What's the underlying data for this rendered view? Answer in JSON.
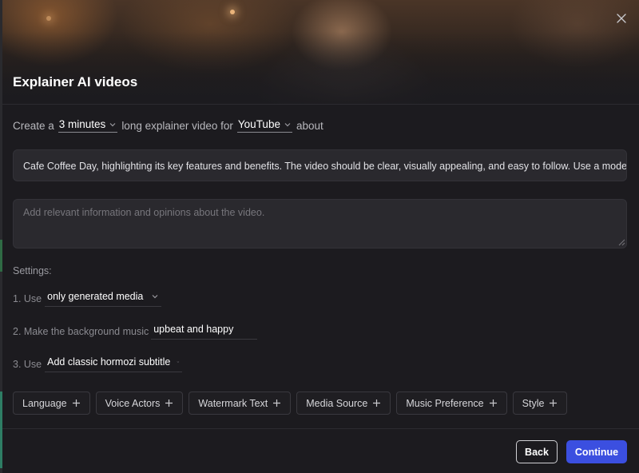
{
  "modal": {
    "title": "Explainer AI videos",
    "close_icon": "close-icon"
  },
  "prompt": {
    "prefix": "Create a",
    "duration": "3 minutes",
    "middle": "long explainer video for",
    "platform": "YouTube",
    "suffix": "about"
  },
  "topic": {
    "value": "Cafe Coffee Day, highlighting its key features and benefits. The video should be clear, visually appealing, and easy to follow. Use a moder"
  },
  "info": {
    "placeholder": "Add relevant information and opinions about the video."
  },
  "settings": {
    "label": "Settings:",
    "media_prefix": "1. Use",
    "media_value": "only generated media",
    "music_prefix": "2. Make the background music",
    "music_value": "upbeat and happy",
    "subtitle_prefix": "3. Use",
    "subtitle_value": "Add classic hormozi subtitle"
  },
  "chips": [
    {
      "label": "Language"
    },
    {
      "label": "Voice Actors"
    },
    {
      "label": "Watermark Text"
    },
    {
      "label": "Media Source"
    },
    {
      "label": "Music Preference"
    },
    {
      "label": "Style"
    }
  ],
  "footer": {
    "back_label": "Back",
    "continue_label": "Continue"
  },
  "colors": {
    "accent": "#3b4fe0",
    "background": "#1c1b1f"
  }
}
